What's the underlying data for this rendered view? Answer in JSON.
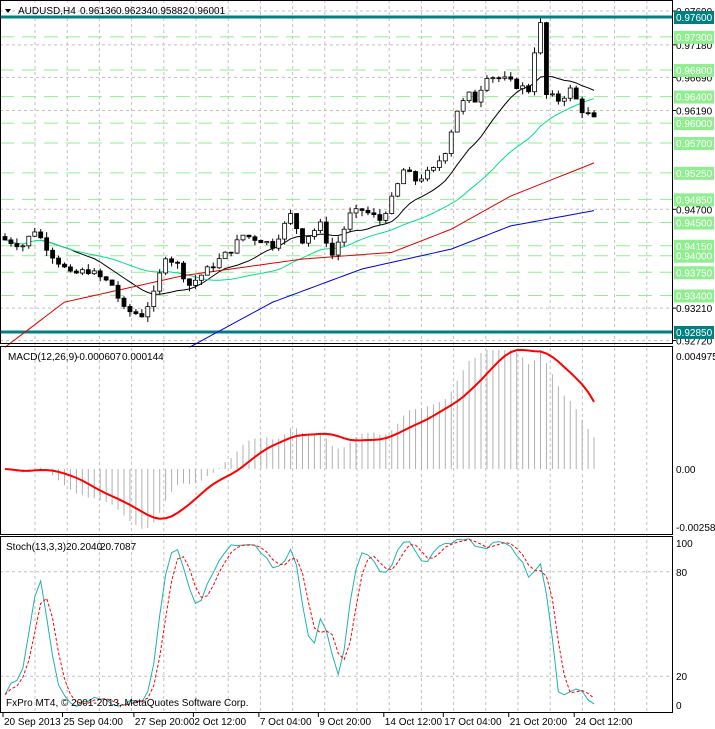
{
  "header": {
    "symbol": "AUDUSD,H4",
    "open": "0.96136",
    "high": "0.96234",
    "low": "0.95882",
    "close": "0.96001"
  },
  "macd_header": {
    "label": "MACD(12,26,9)",
    "main": "-0.000607",
    "signal": "0.000144"
  },
  "stoch_header": {
    "label": "Stoch(13,3,3)",
    "k": "20.2040",
    "d": "20.7087"
  },
  "copyright": "FxPro MT4, © 2001-2013, MetaQuotes Software Corp.",
  "colors": {
    "teal": "#008080",
    "level_green": "#90EE90",
    "sma_fast": "#000000",
    "sma_mid": "#00E08A",
    "sma_slow": "#E00000",
    "sma_long": "#0000E0",
    "macd_signal": "#FF0000",
    "stoch_k": "#20B2AA",
    "stoch_d": "#FF0000"
  },
  "chart_data": {
    "type": "candlestick",
    "price_range": [
      0.9272,
      0.9782
    ],
    "keypoints": [
      [
        0,
        0.9424
      ],
      [
        3,
        0.9416
      ],
      [
        5,
        0.9439
      ],
      [
        8,
        0.9401
      ],
      [
        11,
        0.9371
      ],
      [
        14,
        0.9378
      ],
      [
        18,
        0.9356
      ],
      [
        20,
        0.9318
      ],
      [
        23,
        0.9311
      ],
      [
        25,
        0.9341
      ],
      [
        27,
        0.9401
      ],
      [
        29,
        0.9386
      ],
      [
        31,
        0.9356
      ],
      [
        33,
        0.9371
      ],
      [
        35,
        0.9386
      ],
      [
        38,
        0.9409
      ],
      [
        40,
        0.9431
      ],
      [
        43,
        0.9424
      ],
      [
        45,
        0.9416
      ],
      [
        48,
        0.9461
      ],
      [
        50,
        0.9424
      ],
      [
        53,
        0.9446
      ],
      [
        55,
        0.9401
      ],
      [
        58,
        0.9461
      ],
      [
        60,
        0.9469
      ],
      [
        63,
        0.9454
      ],
      [
        65,
        0.9484
      ],
      [
        67,
        0.9529
      ],
      [
        69,
        0.9514
      ],
      [
        72,
        0.9529
      ],
      [
        74,
        0.9559
      ],
      [
        76,
        0.962
      ],
      [
        78,
        0.9642
      ],
      [
        79,
        0.9635
      ],
      [
        81,
        0.9673
      ],
      [
        84,
        0.9665
      ],
      [
        86,
        0.9657
      ],
      [
        88,
        0.965
      ],
      [
        89,
        0.971
      ],
      [
        90,
        0.9748
      ],
      [
        91,
        0.9642
      ],
      [
        93,
        0.9635
      ],
      [
        94,
        0.9642
      ],
      [
        95,
        0.965
      ],
      [
        97,
        0.962
      ],
      [
        99,
        0.9605
      ]
    ],
    "ma_red": [
      [
        0,
        0.9262
      ],
      [
        10,
        0.933
      ],
      [
        30,
        0.937
      ],
      [
        50,
        0.9395
      ],
      [
        65,
        0.9405
      ],
      [
        75,
        0.944
      ],
      [
        85,
        0.949
      ],
      [
        99,
        0.954
      ]
    ],
    "ma_blue": [
      [
        31,
        0.9262
      ],
      [
        45,
        0.933
      ],
      [
        60,
        0.938
      ],
      [
        75,
        0.941
      ],
      [
        85,
        0.9445
      ],
      [
        99,
        0.9468
      ]
    ],
    "levels_solid": [
      {
        "price": 0.976,
        "label": "0.97600"
      },
      {
        "price": 0.9285,
        "label": "0.92850"
      }
    ],
    "levels_dashed": [
      {
        "price": 0.973,
        "label": "0.97300"
      },
      {
        "price": 0.968,
        "label": "0.96800"
      },
      {
        "price": 0.964,
        "label": "0.96400"
      },
      {
        "price": 0.96,
        "label": "0.96000"
      },
      {
        "price": 0.957,
        "label": "0.95700"
      },
      {
        "price": 0.9525,
        "label": "0.95250"
      },
      {
        "price": 0.9485,
        "label": "0.94850"
      },
      {
        "price": 0.945,
        "label": "0.94500"
      },
      {
        "price": 0.9415,
        "label": "0.94150"
      },
      {
        "price": 0.94,
        "label": "0.94000"
      },
      {
        "price": 0.9375,
        "label": "0.93750"
      },
      {
        "price": 0.934,
        "label": "0.93400"
      }
    ],
    "price_ticks": [
      {
        "price": 0.9769,
        "label": "0.97690"
      },
      {
        "price": 0.9718,
        "label": "0.97180"
      },
      {
        "price": 0.9669,
        "label": "0.96690"
      },
      {
        "price": 0.9619,
        "label": "0.96190"
      },
      {
        "price": 0.947,
        "label": "0.94700"
      },
      {
        "price": 0.9321,
        "label": "0.93210"
      },
      {
        "price": 0.9272,
        "label": "0.92720"
      }
    ],
    "macd_ticks": [
      {
        "v": 0.004975,
        "label": "0.004975"
      },
      {
        "v": 0,
        "label": "0.00"
      },
      {
        "v": -0.002586,
        "label": "-0.002586"
      }
    ],
    "stoch_ticks": [
      {
        "v": 100,
        "label": "100"
      },
      {
        "v": 80,
        "label": "80"
      },
      {
        "v": 20,
        "label": "20"
      },
      {
        "v": 0,
        "label": "0"
      }
    ],
    "time_labels": [
      {
        "bar": 0,
        "label": "20 Sep 2013"
      },
      {
        "bar": 10,
        "label": "25 Sep 04:00"
      },
      {
        "bar": 22,
        "label": "27 Sep 20:00"
      },
      {
        "bar": 32,
        "label": "2 Oct 12:00"
      },
      {
        "bar": 43,
        "label": "7 Oct 04:00"
      },
      {
        "bar": 53,
        "label": "9 Oct 20:00"
      },
      {
        "bar": 64,
        "label": "14 Oct 12:00"
      },
      {
        "bar": 74,
        "label": "17 Oct 04:00"
      },
      {
        "bar": 85,
        "label": "21 Oct 20:00"
      },
      {
        "bar": 96,
        "label": "24 Oct 12:00"
      }
    ]
  }
}
